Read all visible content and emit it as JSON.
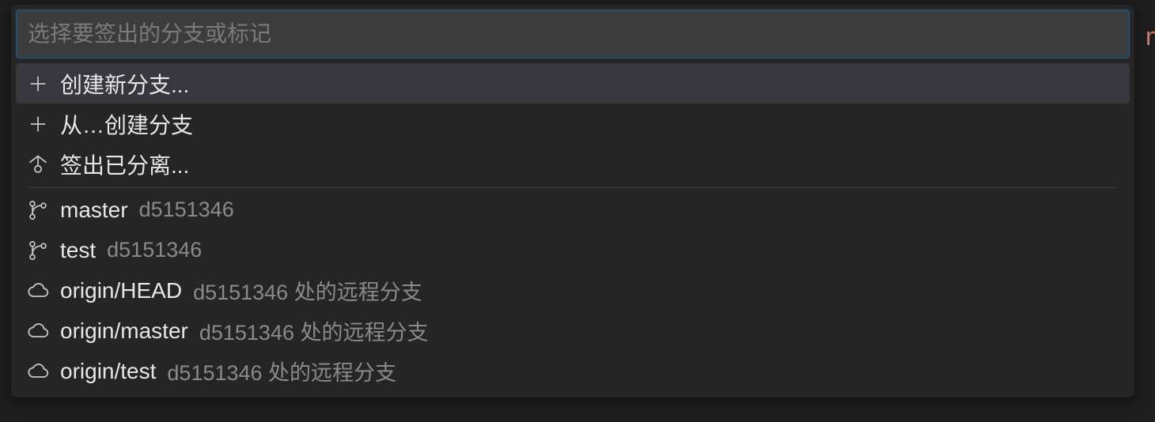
{
  "input": {
    "placeholder": "选择要签出的分支或标记",
    "value": ""
  },
  "actions": [
    {
      "icon": "plus",
      "label": "创建新分支...",
      "selected": true
    },
    {
      "icon": "plus",
      "label": "从…创建分支",
      "selected": false
    },
    {
      "icon": "tag",
      "label": "签出已分离...",
      "selected": false
    }
  ],
  "branches": [
    {
      "icon": "branch",
      "name": "master",
      "desc": "d5151346"
    },
    {
      "icon": "branch",
      "name": "test",
      "desc": "d5151346"
    },
    {
      "icon": "cloud",
      "name": "origin/HEAD",
      "desc": "d5151346 处的远程分支"
    },
    {
      "icon": "cloud",
      "name": "origin/master",
      "desc": "d5151346 处的远程分支"
    },
    {
      "icon": "cloud",
      "name": "origin/test",
      "desc": "d5151346 处的远程分支"
    }
  ],
  "overflow_char": "n"
}
